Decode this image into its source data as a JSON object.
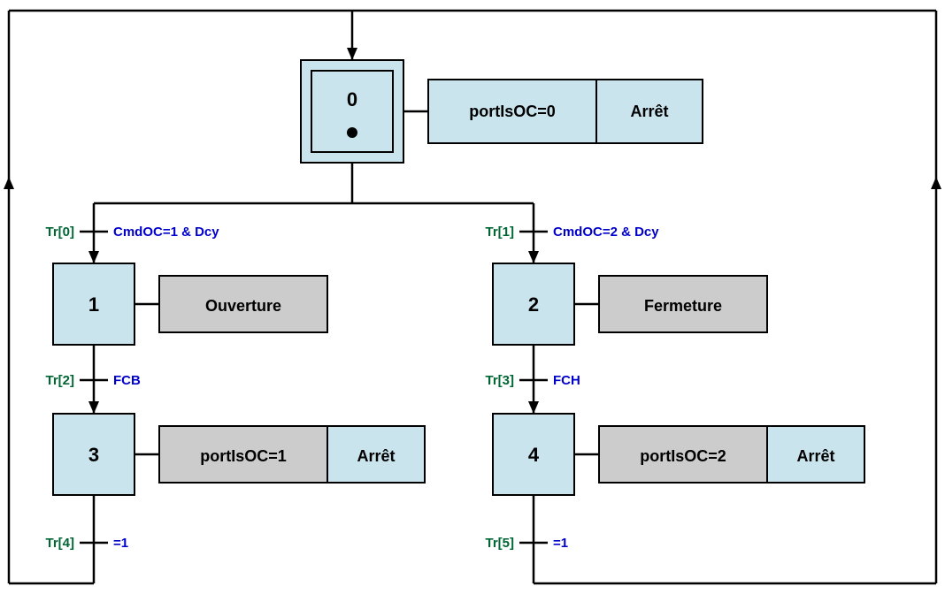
{
  "steps": {
    "s0": {
      "num": "0",
      "actions": [
        "portIsOC=0",
        "Arrêt"
      ]
    },
    "s1": {
      "num": "1",
      "actions": [
        "Ouverture"
      ]
    },
    "s2": {
      "num": "2",
      "actions": [
        "Fermeture"
      ]
    },
    "s3": {
      "num": "3",
      "actions": [
        "portIsOC=1",
        "Arrêt"
      ]
    },
    "s4": {
      "num": "4",
      "actions": [
        "portIsOC=2",
        "Arrêt"
      ]
    }
  },
  "transitions": {
    "t0": {
      "label": "Tr[0]",
      "cond": "CmdOC=1 & Dcy"
    },
    "t1": {
      "label": "Tr[1]",
      "cond": "CmdOC=2 & Dcy"
    },
    "t2": {
      "label": "Tr[2]",
      "cond": "FCB"
    },
    "t3": {
      "label": "Tr[3]",
      "cond": "FCH"
    },
    "t4": {
      "label": "Tr[4]",
      "cond": "=1"
    },
    "t5": {
      "label": "Tr[5]",
      "cond": "=1"
    }
  }
}
